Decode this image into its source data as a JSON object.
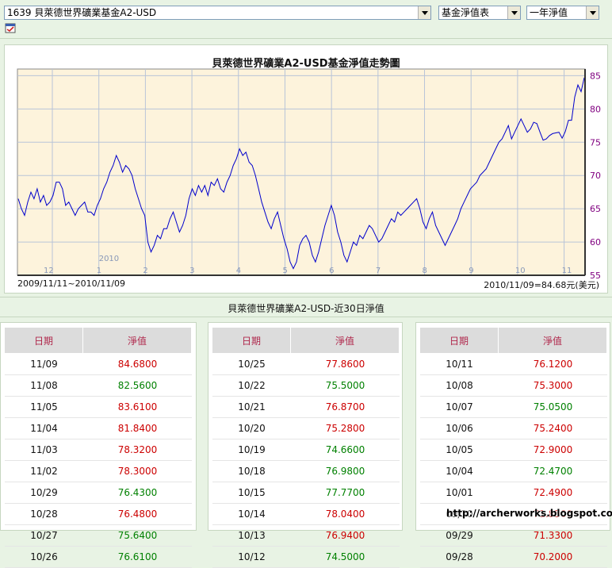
{
  "selectors": {
    "fund": "1639 貝萊德世界礦業基金A2-USD",
    "chart_kind": "基金淨值表",
    "period": "一年淨值"
  },
  "chart_data": {
    "type": "line",
    "title": "貝萊德世界礦業A2-USD基金淨值走勢圖",
    "ylim": [
      55,
      86
    ],
    "yticks": [
      55,
      60,
      65,
      70,
      75,
      80,
      85
    ],
    "month_labels": [
      "12",
      "1",
      "2",
      "3",
      "4",
      "5",
      "6",
      "7",
      "8",
      "9",
      "10",
      "11"
    ],
    "year_label": "2010",
    "range_text": "2009/11/11~2010/11/09",
    "latest_text": "2010/11/09=84.68元(美元)",
    "grid": true,
    "series": [
      {
        "values": [
          66.5,
          65.0,
          64.0,
          66.0,
          67.5,
          66.5,
          68.0,
          66.0,
          67.0,
          65.5,
          66.0,
          67.0,
          69.0,
          69.0,
          68.0,
          65.5,
          66.0,
          65.0,
          64.0,
          65.0,
          65.5,
          66.0,
          64.5,
          64.5,
          64.0,
          65.5,
          66.5,
          68.0,
          69.0,
          70.5,
          71.5,
          73.0,
          72.0,
          70.5,
          71.5,
          71.0,
          70.0,
          68.0,
          66.5,
          65.0,
          64.0,
          60.0,
          58.5,
          59.5,
          61.0,
          60.5,
          62.0,
          62.0,
          63.5,
          64.5,
          63.0,
          61.5,
          62.5,
          64.0,
          66.5,
          68.0,
          67.0,
          68.5,
          67.5,
          68.5,
          67.0,
          69.0,
          68.5,
          69.5,
          68.0,
          67.5,
          69.0,
          70.0,
          71.5,
          72.5,
          74.0,
          73.0,
          73.5,
          72.0,
          71.5,
          70.0,
          68.0,
          66.0,
          64.5,
          63.0,
          62.0,
          63.5,
          64.5,
          62.5,
          60.5,
          59.0,
          57.0,
          56.0,
          57.0,
          59.5,
          60.5,
          61.0,
          60.0,
          58.0,
          57.0,
          58.5,
          60.5,
          62.5,
          64.0,
          65.5,
          64.0,
          61.5,
          60.0,
          58.0,
          57.0,
          58.5,
          60.0,
          59.5,
          61.0,
          60.5,
          61.5,
          62.5,
          62.0,
          61.0,
          60.0,
          60.5,
          61.5,
          62.5,
          63.5,
          63.0,
          64.5,
          64.0,
          64.5,
          65.0,
          65.5,
          66.0,
          66.5,
          65.0,
          63.0,
          62.0,
          63.5,
          64.5,
          62.5,
          61.5,
          60.5,
          59.5,
          60.5,
          61.5,
          62.5,
          63.5,
          65.0,
          66.0,
          67.0,
          68.0,
          68.5,
          69.0,
          70.0,
          70.5,
          71.0,
          72.0,
          73.0,
          74.0,
          75.0,
          75.5,
          76.5,
          77.5,
          75.5,
          76.5,
          77.5,
          78.5,
          77.5,
          76.5,
          77.0,
          78.0,
          77.8,
          76.5,
          75.3,
          75.5,
          76.0,
          76.3,
          76.4,
          76.5,
          75.6,
          76.6,
          78.3,
          78.3,
          81.8,
          83.6,
          82.6,
          84.7
        ]
      }
    ]
  },
  "section_title": "貝萊德世界礦業A2-USD-近30日淨值",
  "table_headers": {
    "date": "日期",
    "nav": "淨值"
  },
  "tables": [
    [
      {
        "date": "11/09",
        "nav": "84.6800",
        "dir": "up"
      },
      {
        "date": "11/08",
        "nav": "82.5600",
        "dir": "dn"
      },
      {
        "date": "11/05",
        "nav": "83.6100",
        "dir": "up"
      },
      {
        "date": "11/04",
        "nav": "81.8400",
        "dir": "up"
      },
      {
        "date": "11/03",
        "nav": "78.3200",
        "dir": "up"
      },
      {
        "date": "11/02",
        "nav": "78.3000",
        "dir": "up"
      },
      {
        "date": "10/29",
        "nav": "76.4300",
        "dir": "dn"
      },
      {
        "date": "10/28",
        "nav": "76.4800",
        "dir": "up"
      },
      {
        "date": "10/27",
        "nav": "75.6400",
        "dir": "dn"
      },
      {
        "date": "10/26",
        "nav": "76.6100",
        "dir": "dn"
      }
    ],
    [
      {
        "date": "10/25",
        "nav": "77.8600",
        "dir": "up"
      },
      {
        "date": "10/22",
        "nav": "75.5000",
        "dir": "dn"
      },
      {
        "date": "10/21",
        "nav": "76.8700",
        "dir": "up"
      },
      {
        "date": "10/20",
        "nav": "75.2800",
        "dir": "up"
      },
      {
        "date": "10/19",
        "nav": "74.6600",
        "dir": "dn"
      },
      {
        "date": "10/18",
        "nav": "76.9800",
        "dir": "dn"
      },
      {
        "date": "10/15",
        "nav": "77.7700",
        "dir": "dn"
      },
      {
        "date": "10/14",
        "nav": "78.0400",
        "dir": "up"
      },
      {
        "date": "10/13",
        "nav": "76.9400",
        "dir": "up"
      },
      {
        "date": "10/12",
        "nav": "74.5000",
        "dir": "dn"
      }
    ],
    [
      {
        "date": "10/11",
        "nav": "76.1200",
        "dir": "up"
      },
      {
        "date": "10/08",
        "nav": "75.3000",
        "dir": "up"
      },
      {
        "date": "10/07",
        "nav": "75.0500",
        "dir": "dn"
      },
      {
        "date": "10/06",
        "nav": "75.2400",
        "dir": "up"
      },
      {
        "date": "10/05",
        "nav": "72.9000",
        "dir": "up"
      },
      {
        "date": "10/04",
        "nav": "72.4700",
        "dir": "dn"
      },
      {
        "date": "10/01",
        "nav": "72.4900",
        "dir": "up"
      },
      {
        "date": "09/30",
        "nav": "71.8500",
        "dir": "up"
      },
      {
        "date": "09/29",
        "nav": "71.3300",
        "dir": "up"
      },
      {
        "date": "09/28",
        "nav": "70.2000",
        "dir": "up"
      }
    ]
  ],
  "watermark": "http://archerworks.blogspot.com",
  "colors": {
    "up": "#cc0000",
    "down": "#008000",
    "line": "#0000cc",
    "plot_bg": "#fdf3dc"
  }
}
